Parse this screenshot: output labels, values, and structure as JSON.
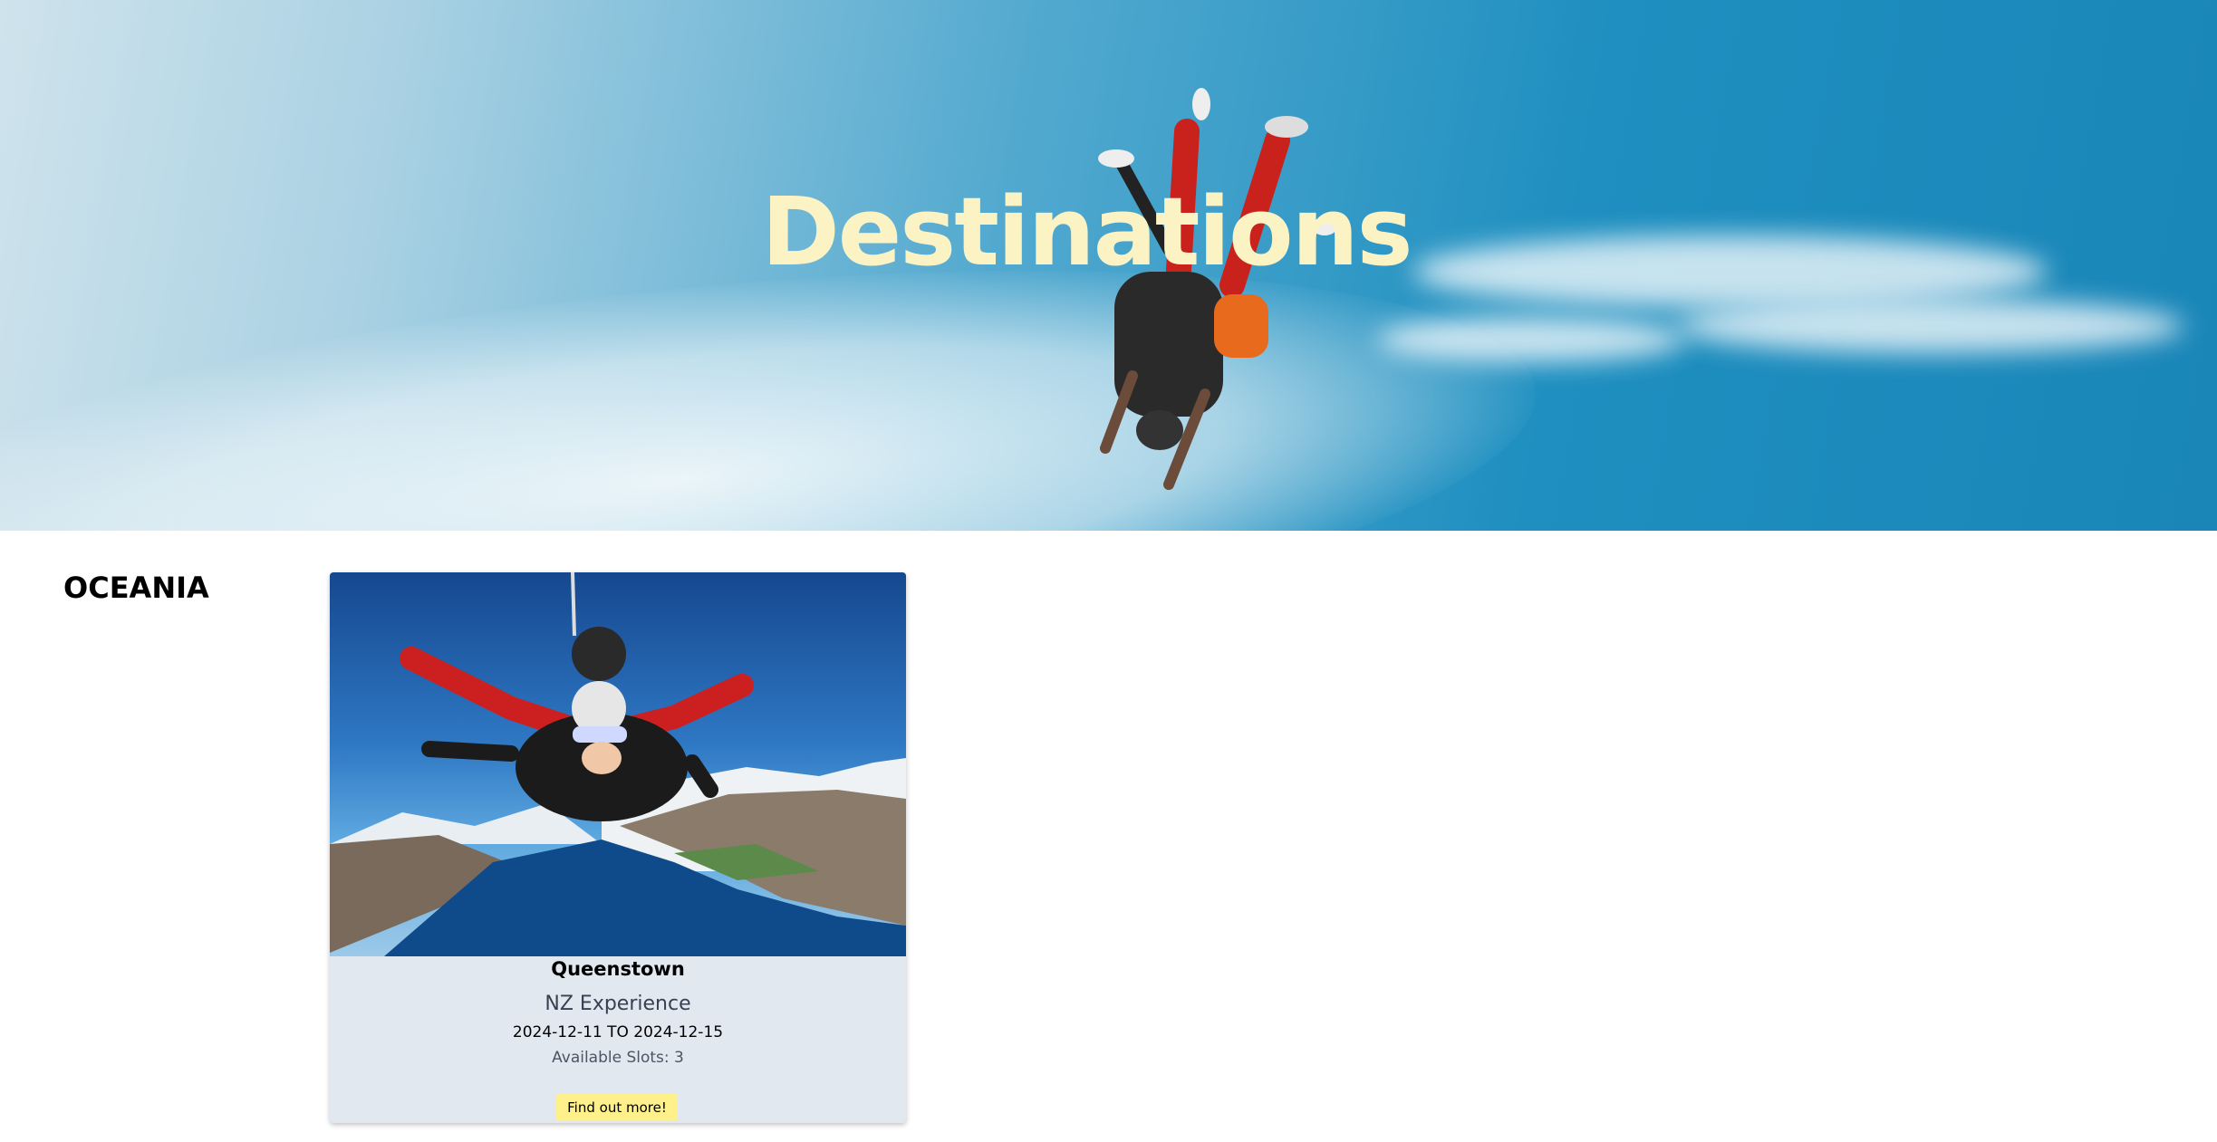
{
  "hero": {
    "title": "Destinations",
    "image": "skydiver-upside-down-sky-photo"
  },
  "regions": [
    {
      "name": "OCEANIA",
      "destinations": [
        {
          "image": "tandem-skydive-over-lake-mountains-photo",
          "title": "Queenstown",
          "subtitle": "NZ Experience",
          "dates": "2024-12-11 TO 2024-12-15",
          "slots": "Available Slots: 3",
          "button_label": "Find out more!"
        }
      ]
    }
  ],
  "colors": {
    "hero_title": "#fcf3c4",
    "card_background": "#e2e8f0",
    "button_background": "#fef08a"
  }
}
